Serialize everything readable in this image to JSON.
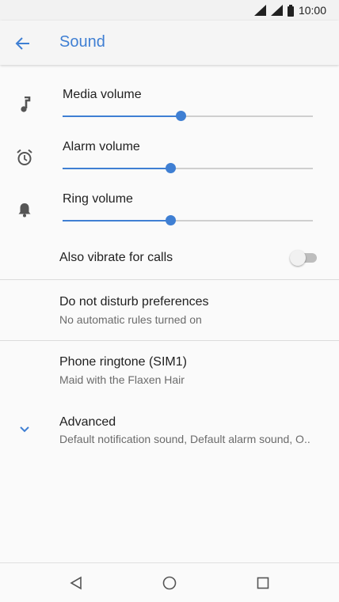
{
  "status_bar": {
    "time": "10:00"
  },
  "header": {
    "title": "Sound",
    "back_icon": "arrow-left-icon"
  },
  "sliders": [
    {
      "label": "Media volume",
      "icon": "music-note-icon",
      "level": 0.47
    },
    {
      "label": "Alarm volume",
      "icon": "alarm-clock-icon",
      "level": 0.43
    },
    {
      "label": "Ring volume",
      "icon": "bell-icon",
      "level": 0.43
    }
  ],
  "vibrate": {
    "label": "Also vibrate for calls",
    "enabled": false
  },
  "dnd": {
    "title": "Do not disturb preferences",
    "summary": "No automatic rules turned on"
  },
  "ringtone": {
    "title": "Phone ringtone (SIM1)",
    "summary": "Maid with the Flaxen Hair"
  },
  "advanced": {
    "title": "Advanced",
    "summary": "Default notification sound, Default alarm sound, O..",
    "icon": "chevron-down-icon"
  },
  "colors": {
    "accent": "#3f7fd3",
    "track": "#cfcfcf",
    "text_secondary": "#6b6b6b"
  },
  "nav": {
    "back_icon": "nav-back-icon",
    "home_icon": "nav-home-icon",
    "recents_icon": "nav-recents-icon"
  }
}
